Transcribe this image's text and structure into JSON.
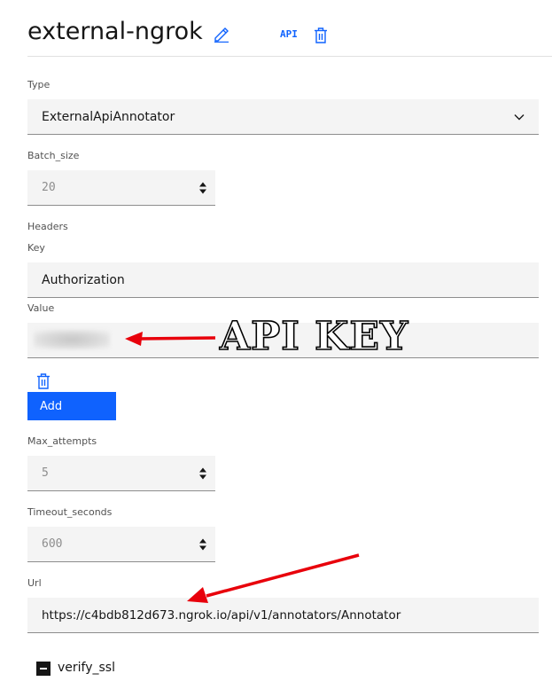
{
  "header": {
    "title": "external-ngrok",
    "api_label": "API"
  },
  "form": {
    "type": {
      "label": "Type",
      "value": "ExternalApiAnnotator"
    },
    "batch_size": {
      "label": "Batch_size",
      "value": "20"
    },
    "headers": {
      "label": "Headers",
      "key_label": "Key",
      "key_value": "Authorization",
      "value_label": "Value",
      "add_label": "Add"
    },
    "max_attempts": {
      "label": "Max_attempts",
      "value": "5"
    },
    "timeout_seconds": {
      "label": "Timeout_seconds",
      "value": "600"
    },
    "url": {
      "label": "Url",
      "value": "https://c4bdb812d673.ngrok.io/api/v1/annotators/Annotator"
    },
    "verify_ssl": {
      "label": "verify_ssl",
      "state": "indeterminate"
    }
  },
  "annotations": {
    "api_key_text": "API KEY",
    "arrow_color": "#e8000b"
  },
  "colors": {
    "accent": "#0f62fe",
    "field_bg": "#f4f4f4",
    "text": "#161616"
  }
}
